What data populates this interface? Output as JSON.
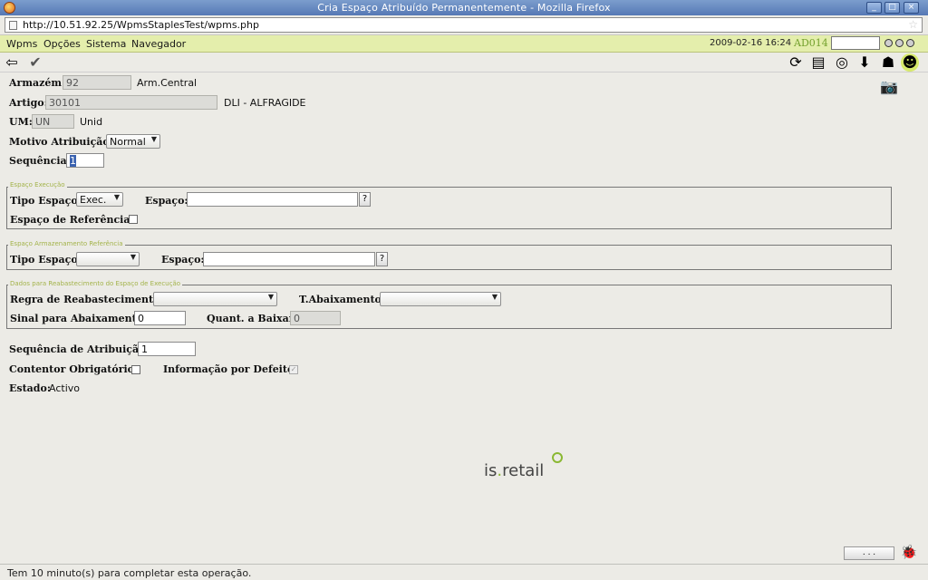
{
  "window": {
    "title": "Cria Espaço Atribuído Permanentemente - Mozilla Firefox",
    "controls": {
      "minimize": "_",
      "maximize": "□",
      "close": "×"
    }
  },
  "browser": {
    "url": "http://10.51.92.25/WpmsStaplesTest/wpms.php"
  },
  "menu": {
    "items": [
      "Wpms",
      "Opções",
      "Sistema",
      "Navegador"
    ],
    "datetime": "2009-02-16 16:24",
    "user": "AD014"
  },
  "form": {
    "armazem": {
      "label": "Armazém:",
      "value": "92",
      "desc": "Arm.Central"
    },
    "artigo": {
      "label": "Artigo:",
      "value": "30101",
      "desc": "DLI - ALFRAGIDE"
    },
    "um": {
      "label": "UM:",
      "value": "UN",
      "desc": "Unid"
    },
    "motivo": {
      "label": "Motivo Atribuição:",
      "value": "Normal"
    },
    "sequencia": {
      "label": "Sequência:",
      "value": "1"
    }
  },
  "espaco_execucao": {
    "legend": "Espaço Execução",
    "tipo_label": "Tipo Espaço:",
    "tipo_value": "Exec.",
    "espaco_label": "Espaço:",
    "espaco_value": "",
    "ref_label": "Espaço de Referência:",
    "lookup": "?"
  },
  "espaco_armazenamento": {
    "legend": "Espaço Armazenamento Referência",
    "tipo_label": "Tipo Espaço:",
    "tipo_value": "",
    "espaco_label": "Espaço:",
    "espaco_value": "",
    "lookup": "?"
  },
  "reabastecimento": {
    "legend": "Dados para Reabastecimento do Espaço de Execução",
    "regra_label": "Regra de Reabastecimento:",
    "regra_value": "",
    "abaix_label": "T.Abaixamento:",
    "abaix_value": "",
    "sinal_label": "Sinal para Abaixamento:",
    "sinal_value": "0",
    "quant_label": "Quant. a Baixar:",
    "quant_value": "0"
  },
  "bottom": {
    "seq_atrib_label": "Sequência de Atribuição:",
    "seq_atrib_value": "1",
    "contentor_label": "Contentor Obrigatório:",
    "info_label": "Informação por Defeito:",
    "estado_label": "Estado:",
    "estado_value": "Activo"
  },
  "brand": {
    "logo_a": "is",
    "logo_dot": ".",
    "logo_b": "retail"
  },
  "status": {
    "message": "Tem 10 minuto(s) para completar esta operação.",
    "more_button": ". . ."
  },
  "colors": {
    "menubar": "#e4eeac",
    "accent_green": "#8ab832",
    "titlebar": "#5679b5"
  }
}
